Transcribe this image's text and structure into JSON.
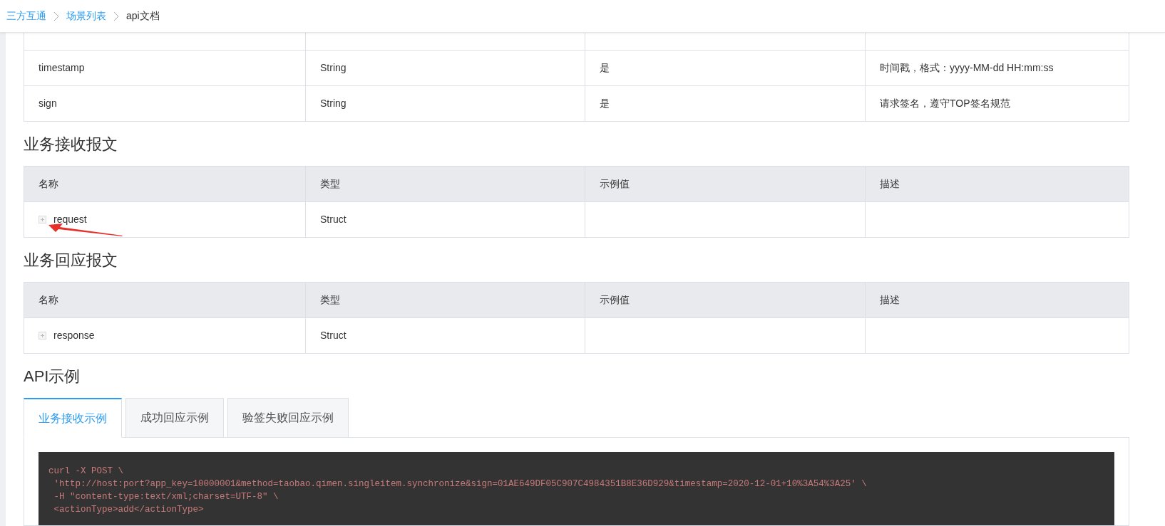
{
  "breadcrumb": [
    {
      "label": "三方互通",
      "link": true
    },
    {
      "label": "场景列表",
      "link": true
    },
    {
      "label": "api文档",
      "link": false
    }
  ],
  "params_table": {
    "rows": [
      {
        "cells": [
          "timestamp",
          "String",
          "是",
          "时间戳，格式：yyyy-MM-dd HH:mm:ss"
        ]
      },
      {
        "cells": [
          "sign",
          "String",
          "是",
          "请求签名，遵守TOP签名规范"
        ]
      }
    ]
  },
  "sections": [
    {
      "title": "业务接收报文",
      "columns": [
        "名称",
        "类型",
        "示例值",
        "描述"
      ],
      "rows": [
        {
          "name": "request",
          "type": "Struct",
          "expanded": false,
          "annotated": true
        }
      ]
    },
    {
      "title": "业务回应报文",
      "columns": [
        "名称",
        "类型",
        "示例值",
        "描述"
      ],
      "rows": [
        {
          "name": "response",
          "type": "Struct",
          "expanded": false
        }
      ]
    }
  ],
  "examples": {
    "title": "API示例",
    "tabs": [
      {
        "label": "业务接收示例",
        "selected": true
      },
      {
        "label": "成功回应示例",
        "selected": false
      },
      {
        "label": "验签失败回应示例",
        "selected": false
      }
    ],
    "code_lines": [
      "curl -X POST \\",
      " 'http://host:port?app_key=10000001&method=taobao.qimen.singleitem.synchronize&sign=01AE649DF05C907C4984351B8E36D929&timestamp=2020-12-01+10%3A54%3A25' \\",
      " -H \"content-type:text/xml;charset=UTF-8\" \\",
      " <actionType>add</actionType>"
    ]
  }
}
